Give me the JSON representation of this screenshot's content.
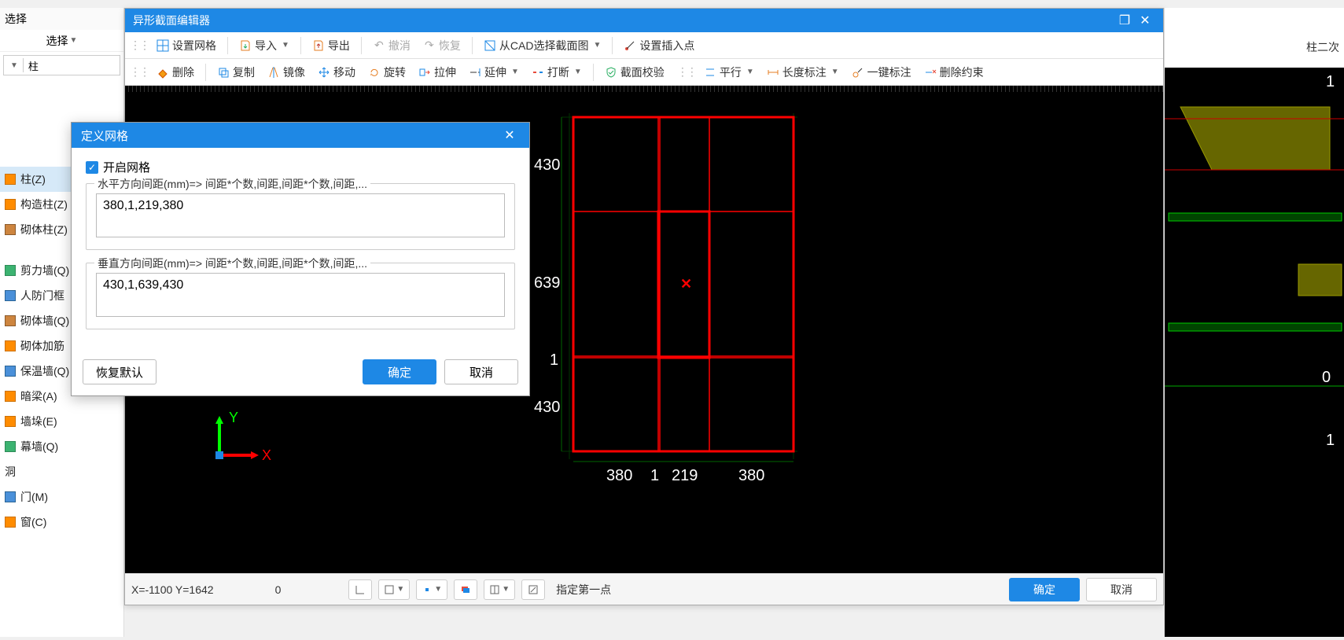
{
  "left": {
    "select_header": "选择",
    "select_label": "选择",
    "dropdown_value": "柱",
    "category_selected": "柱(Z)",
    "items": [
      {
        "label": "柱(Z)",
        "sel": true,
        "ic": "orange"
      },
      {
        "label": "构造柱(Z)",
        "ic": "orange"
      },
      {
        "label": "砌体柱(Z)",
        "ic": "brick"
      }
    ],
    "cat_wall_open": "",
    "wall_items": [
      {
        "label": "剪力墙(Q)",
        "ic": "green"
      },
      {
        "label": "人防门框",
        "ic": "blue"
      },
      {
        "label": "砌体墙(Q)",
        "ic": "brick"
      },
      {
        "label": "砌体加筋",
        "ic": "orange"
      },
      {
        "label": "保温墙(Q)",
        "ic": "blue"
      },
      {
        "label": "暗梁(A)",
        "ic": "orange"
      },
      {
        "label": "墙垛(E)",
        "ic": "orange"
      },
      {
        "label": "幕墙(Q)",
        "ic": "green"
      }
    ],
    "cat_hole": "洞",
    "hole_items": [
      {
        "label": "门(M)",
        "ic": "blue"
      },
      {
        "label": "窗(C)",
        "ic": "orange"
      }
    ]
  },
  "editor": {
    "title": "异形截面编辑器",
    "tb1": {
      "set_grid": "设置网格",
      "import": "导入",
      "export": "导出",
      "undo": "撤消",
      "redo": "恢复",
      "from_cad": "从CAD选择截面图",
      "set_insert": "设置插入点"
    },
    "tb2": {
      "delete": "删除",
      "copy": "复制",
      "mirror": "镜像",
      "move": "移动",
      "rotate": "旋转",
      "stretch": "拉伸",
      "extend": "延伸",
      "break": "打断",
      "validate": "截面校验",
      "parallel": "平行",
      "len_dim": "长度标注",
      "auto_dim": "一键标注",
      "del_const": "删除约束"
    },
    "dims": {
      "v": [
        "430",
        "639",
        "1",
        "430"
      ],
      "h": [
        "380",
        "1",
        "219",
        "380"
      ]
    },
    "axisX": "X",
    "axisY": "Y",
    "bottom": {
      "coords": "X=-1100 Y=1642",
      "zero": "0",
      "prompt": "指定第一点",
      "ok": "确定",
      "cancel": "取消"
    }
  },
  "dialog": {
    "title": "定义网格",
    "enable_grid": "开启网格",
    "h_legend": "水平方向间距(mm)=> 间距*个数,间距,间距*个数,间距,...",
    "h_value": "380,1,219,380",
    "v_legend": "垂直方向间距(mm)=> 间距*个数,间距,间距*个数,间距,...",
    "v_value": "430,1,639,430",
    "restore": "恢复默认",
    "ok": "确定",
    "cancel": "取消"
  },
  "right": {
    "tab": "柱二次"
  }
}
